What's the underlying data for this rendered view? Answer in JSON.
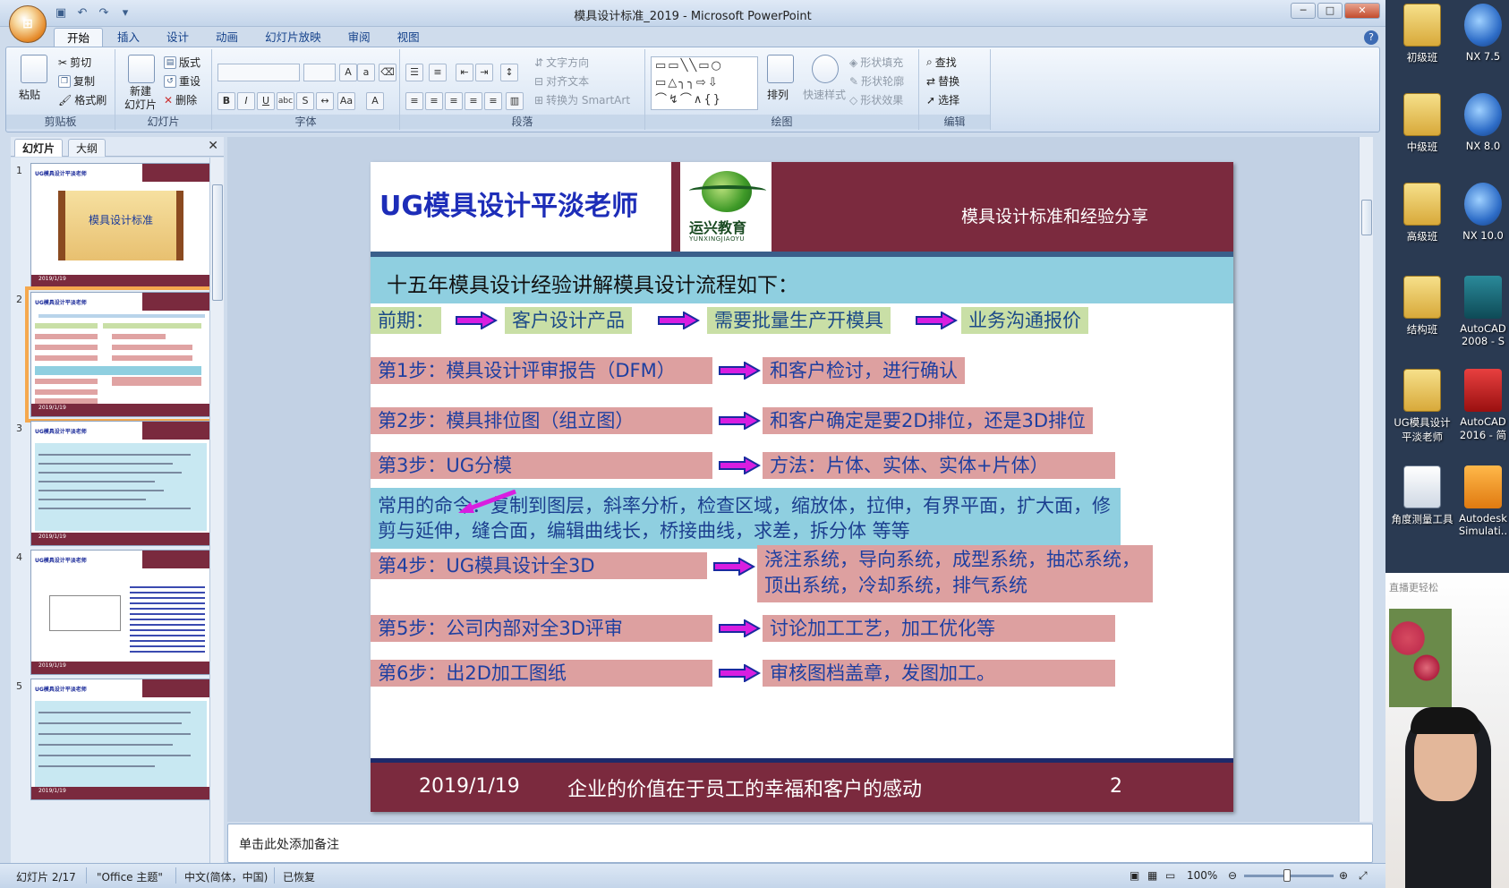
{
  "window": {
    "title": "模具设计标准_2019 - Microsoft PowerPoint",
    "controls": [
      "─",
      "□",
      "✕"
    ]
  },
  "ribbon_tabs": [
    "开始",
    "插入",
    "设计",
    "动画",
    "幻灯片放映",
    "审阅",
    "视图"
  ],
  "ribbon": {
    "clipboard": {
      "label": "剪贴板",
      "paste": "粘贴",
      "cut": "剪切",
      "copy": "复制",
      "format_painter": "格式刷"
    },
    "slides": {
      "label": "幻灯片",
      "new_slide": "新建\n幻灯片",
      "layout": "版式",
      "reset": "重设",
      "delete": "删除"
    },
    "font": {
      "label": "字体"
    },
    "paragraph": {
      "label": "段落",
      "text_direction": "文字方向",
      "align_text": "对齐文本",
      "smartart": "转换为 SmartArt"
    },
    "drawing": {
      "label": "绘图",
      "arrange": "排列",
      "quick_styles": "快速样式",
      "shape_fill": "形状填充",
      "shape_outline": "形状轮廓",
      "shape_effects": "形状效果"
    },
    "editing": {
      "label": "编辑",
      "find": "查找",
      "replace": "替换",
      "select": "选择"
    }
  },
  "panel_tabs": [
    "幻灯片",
    "大纲"
  ],
  "thumbnails": [
    {
      "num": "1",
      "title": "UG模具设计平淡老师",
      "center": "模具设计标准",
      "footer": "2019/1/19"
    },
    {
      "num": "2",
      "title": "UG模具设计平淡老师",
      "footer": "2019/1/19"
    },
    {
      "num": "3",
      "title": "UG模具设计平淡老师",
      "footer": "2019/1/19"
    },
    {
      "num": "4",
      "title": "UG模具设计平淡老师",
      "footer": "2019/1/19"
    },
    {
      "num": "5",
      "title": "UG模具设计平淡老师",
      "footer": "2019/1/19"
    }
  ],
  "slide": {
    "title": "UG模具设计平淡老师",
    "logo_text": "运兴教育",
    "logo_sub": "YUNXINGJIAOYU",
    "subtitle": "模具设计标准和经验分享",
    "intro": "十五年模具设计经验讲解模具设计流程如下：",
    "row0": [
      "前期：",
      "客户设计产品",
      "需要批量生产开模具",
      "业务沟通报价"
    ],
    "step1": [
      "第1步：模具设计评审报告（DFM）",
      "和客户检讨，进行确认"
    ],
    "step2": [
      "第2步：模具排位图（组立图）",
      "和客户确定是要2D排位，还是3D排位"
    ],
    "step3": [
      "第3步：UG分模",
      "方法：片体、实体、实体+片体）"
    ],
    "commands": "常用的命令：复制到图层，斜率分析，检查区域，缩放体，拉伸，有界平面，扩大面，修剪与延伸，缝合面，编辑曲线长，桥接曲线，求差，拆分体 等等",
    "step4": [
      "第4步：UG模具设计全3D",
      "浇注系统，导向系统，成型系统，抽芯系统，顶出系统，冷却系统，排气系统"
    ],
    "step5": [
      "第5步：公司内部对全3D评审",
      "讨论加工工艺，加工优化等"
    ],
    "step6": [
      "第6步：出2D加工图纸",
      "审核图档盖章，发图加工。"
    ],
    "footer_date": "2019/1/19",
    "footer_motto": "企业的价值在于员工的幸福和客户的感动",
    "footer_num": "2"
  },
  "notes_placeholder": "单击此处添加备注",
  "status": {
    "slide": "幻灯片 2/17",
    "theme": "\"Office 主题\"",
    "lang": "中文(简体，中国)",
    "recovered": "已恢复",
    "zoom": "100%"
  },
  "desktop_icons": [
    {
      "label": "初级班",
      "kind": "folder"
    },
    {
      "label": "NX 7.5",
      "kind": "nx"
    },
    {
      "label": "中级班",
      "kind": "folder"
    },
    {
      "label": "NX 8.0",
      "kind": "nx"
    },
    {
      "label": "高级班",
      "kind": "folder"
    },
    {
      "label": "NX 10.0",
      "kind": "nx"
    },
    {
      "label": "结构班",
      "kind": "folder"
    },
    {
      "label": "AutoCAD 2008 - S",
      "kind": "acadw"
    },
    {
      "label": "UG模具设计平淡老师",
      "kind": "folder"
    },
    {
      "label": "AutoCAD 2016 - 简",
      "kind": "acad"
    },
    {
      "label": "角度测量工具",
      "kind": "tool"
    },
    {
      "label": "Autodesk Simulati..",
      "kind": "mf"
    }
  ],
  "webcam_watermark": "直播更轻松"
}
